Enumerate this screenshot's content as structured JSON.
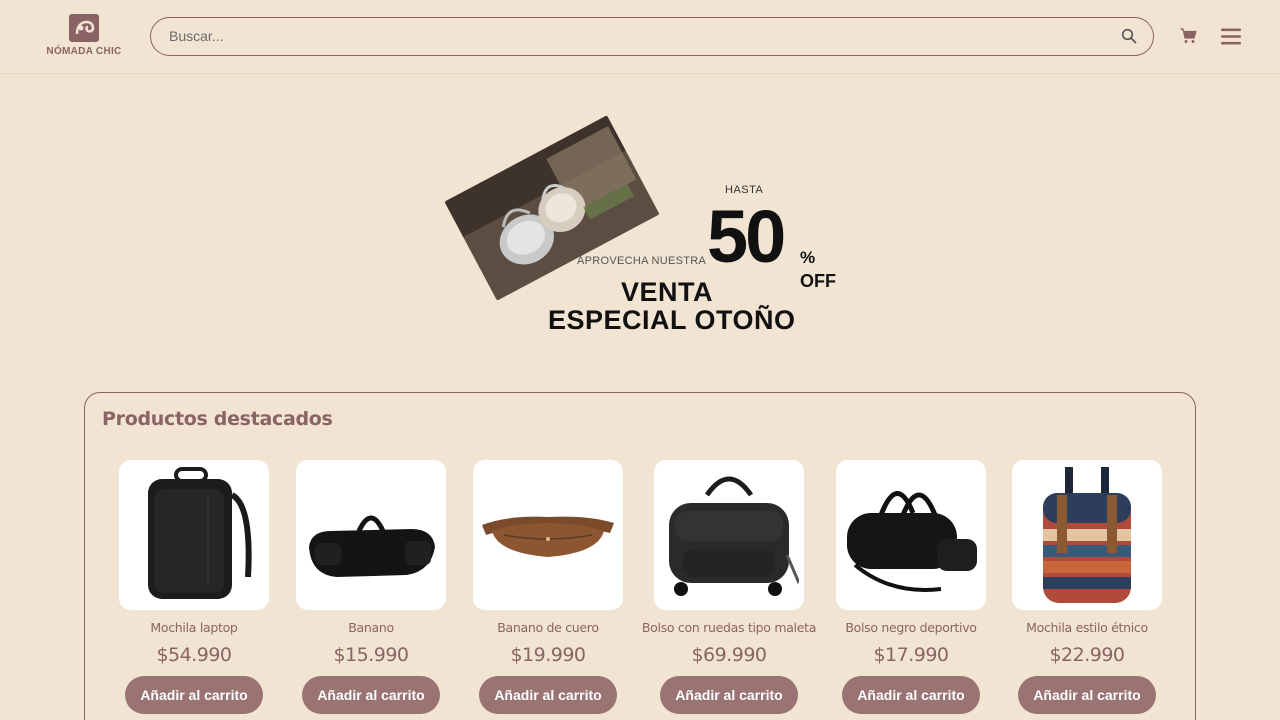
{
  "brand": {
    "name": "NÓMADA CHIC"
  },
  "header": {
    "search_placeholder": "Buscar...",
    "search_icon": "search-icon",
    "cart_icon": "cart-icon",
    "menu_icon": "hamburger-menu-icon"
  },
  "banner": {
    "hasta": "HASTA",
    "aprovecha": "APROVECHA NUESTRA",
    "discount": "50",
    "percent": "%",
    "off": "OFF",
    "line1": "VENTA",
    "line2": "ESPECIAL OTOÑO"
  },
  "featured": {
    "title": "Productos destacados",
    "products": [
      {
        "name": "Mochila laptop",
        "price": "$54.990",
        "button": "Añadir al carrito"
      },
      {
        "name": "Banano",
        "price": "$15.990",
        "button": "Añadir al carrito"
      },
      {
        "name": "Banano de cuero",
        "price": "$19.990",
        "button": "Añadir al carrito"
      },
      {
        "name": "Bolso con ruedas tipo maleta",
        "price": "$69.990",
        "button": "Añadir al carrito"
      },
      {
        "name": "Bolso negro deportivo",
        "price": "$17.990",
        "button": "Añadir al carrito"
      },
      {
        "name": "Mochila estilo étnico",
        "price": "$22.990",
        "button": "Añadir al carrito"
      }
    ]
  },
  "colors": {
    "background": "#f2e4d2",
    "accent": "#8a6464",
    "button": "#9a7373",
    "button_text": "#ffffff"
  }
}
